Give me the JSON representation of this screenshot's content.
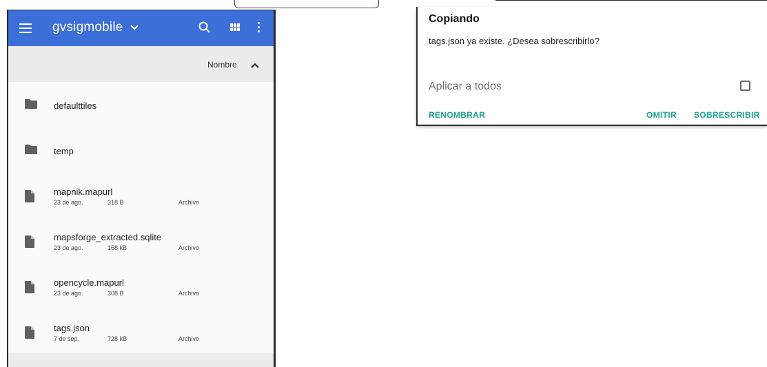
{
  "file_manager": {
    "folder_name": "gvsigmobile",
    "dropdown_icon": "chevron-down-icon",
    "actions": [
      "search-icon",
      "grid-view-icon",
      "more-vert-icon"
    ],
    "sort_label": "Nombre",
    "sort_direction_icon": "chevron-up-icon",
    "items": [
      {
        "kind": "folder",
        "name": "defaulttiles"
      },
      {
        "kind": "folder",
        "name": "temp"
      },
      {
        "kind": "file",
        "name": "mapnik.mapurl",
        "date": "23 de ago.",
        "size": "318 B",
        "type": "Archivo"
      },
      {
        "kind": "file",
        "name": "mapsforge_extracted.sqlite",
        "date": "23 de ago.",
        "size": "158 kB",
        "type": "Archivo"
      },
      {
        "kind": "file",
        "name": "opencycle.mapurl",
        "date": "23 de ago.",
        "size": "308 B",
        "type": "Archivo"
      },
      {
        "kind": "file",
        "name": "tags.json",
        "date": "7 de sep.",
        "size": "728 kB",
        "type": "Archivo"
      }
    ]
  },
  "dialog": {
    "title": "Copiando",
    "message": "tags.json ya existe. ¿Desea sobrescribirlo?",
    "apply_all_label": "Aplicar a todos",
    "apply_all_checked": false,
    "buttons": {
      "rename": "RENOMBRAR",
      "skip": "OMITIR",
      "overwrite": "SOBRESCRIBIR"
    }
  },
  "colors": {
    "appbar": "#3d6fd8",
    "accent": "#1aa38f",
    "sortbar": "#ececec"
  }
}
